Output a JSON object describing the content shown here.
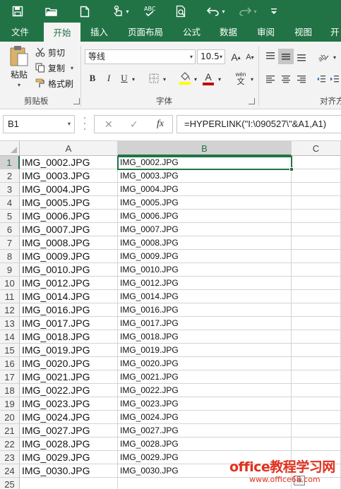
{
  "quick_access": {
    "icons": [
      "save-icon",
      "open-folder-icon",
      "new-file-icon",
      "touch-mode-icon",
      "spelling-icon",
      "print-preview-icon",
      "undo-icon",
      "redo-icon",
      "customize-icon"
    ]
  },
  "tabs": [
    {
      "label": "文件",
      "active": false
    },
    {
      "label": "开始",
      "active": true
    },
    {
      "label": "插入",
      "active": false
    },
    {
      "label": "页面布局",
      "active": false
    },
    {
      "label": "公式",
      "active": false
    },
    {
      "label": "数据",
      "active": false
    },
    {
      "label": "审阅",
      "active": false
    },
    {
      "label": "视图",
      "active": false
    },
    {
      "label": "开",
      "active": false
    }
  ],
  "ribbon": {
    "clipboard": {
      "paste_label": "粘贴",
      "cut_label": "剪切",
      "copy_label": "复制",
      "format_painter_label": "格式刷",
      "group_label": "剪贴板"
    },
    "font": {
      "font_name": "等线",
      "font_size": "10.5",
      "grow_label": "A",
      "shrink_label": "A",
      "bold_label": "B",
      "italic_label": "I",
      "underline_label": "U",
      "font_color_label": "A",
      "phonetic_label": "wén",
      "group_label": "字体",
      "accent_font_color": "#c00000",
      "accent_highlight": "#ffff00"
    },
    "alignment": {
      "group_label": "对齐方"
    }
  },
  "formula_bar": {
    "name_box": "B1",
    "cancel_label": "✕",
    "enter_label": "✓",
    "fx_label": "fx",
    "formula": "=HYPERLINK(\"I:\\090527\\\"&A1,A1)"
  },
  "grid": {
    "columns": [
      "A",
      "B",
      "C"
    ],
    "selected_column": "B",
    "active_cell": "B1",
    "rows": [
      {
        "num": "1",
        "a": "IMG_0002.JPG",
        "b": "IMG_0002.JPG"
      },
      {
        "num": "2",
        "a": "IMG_0003.JPG",
        "b": "IMG_0003.JPG"
      },
      {
        "num": "3",
        "a": "IMG_0004.JPG",
        "b": "IMG_0004.JPG"
      },
      {
        "num": "4",
        "a": "IMG_0005.JPG",
        "b": "IMG_0005.JPG"
      },
      {
        "num": "5",
        "a": "IMG_0006.JPG",
        "b": "IMG_0006.JPG"
      },
      {
        "num": "6",
        "a": "IMG_0007.JPG",
        "b": "IMG_0007.JPG"
      },
      {
        "num": "7",
        "a": "IMG_0008.JPG",
        "b": "IMG_0008.JPG"
      },
      {
        "num": "8",
        "a": "IMG_0009.JPG",
        "b": "IMG_0009.JPG"
      },
      {
        "num": "9",
        "a": "IMG_0010.JPG",
        "b": "IMG_0010.JPG"
      },
      {
        "num": "10",
        "a": "IMG_0012.JPG",
        "b": "IMG_0012.JPG"
      },
      {
        "num": "11",
        "a": "IMG_0014.JPG",
        "b": "IMG_0014.JPG"
      },
      {
        "num": "12",
        "a": "IMG_0016.JPG",
        "b": "IMG_0016.JPG"
      },
      {
        "num": "13",
        "a": "IMG_0017.JPG",
        "b": "IMG_0017.JPG"
      },
      {
        "num": "14",
        "a": "IMG_0018.JPG",
        "b": "IMG_0018.JPG"
      },
      {
        "num": "15",
        "a": "IMG_0019.JPG",
        "b": "IMG_0019.JPG"
      },
      {
        "num": "16",
        "a": "IMG_0020.JPG",
        "b": "IMG_0020.JPG"
      },
      {
        "num": "17",
        "a": "IMG_0021.JPG",
        "b": "IMG_0021.JPG"
      },
      {
        "num": "18",
        "a": "IMG_0022.JPG",
        "b": "IMG_0022.JPG"
      },
      {
        "num": "19",
        "a": "IMG_0023.JPG",
        "b": "IMG_0023.JPG"
      },
      {
        "num": "20",
        "a": "IMG_0024.JPG",
        "b": "IMG_0024.JPG"
      },
      {
        "num": "21",
        "a": "IMG_0027.JPG",
        "b": "IMG_0027.JPG"
      },
      {
        "num": "22",
        "a": "IMG_0028.JPG",
        "b": "IMG_0028.JPG"
      },
      {
        "num": "23",
        "a": "IMG_0029.JPG",
        "b": "IMG_0029.JPG"
      },
      {
        "num": "24",
        "a": "IMG_0030.JPG",
        "b": "IMG_0030.JPG"
      },
      {
        "num": "25",
        "a": "",
        "b": ""
      }
    ]
  },
  "watermark": {
    "main": "office教程学习网",
    "sub": "www.office68.com"
  },
  "colors": {
    "brand": "#217346",
    "ribbon_bg": "#f3f3f3",
    "watermark": "#e0301e"
  }
}
